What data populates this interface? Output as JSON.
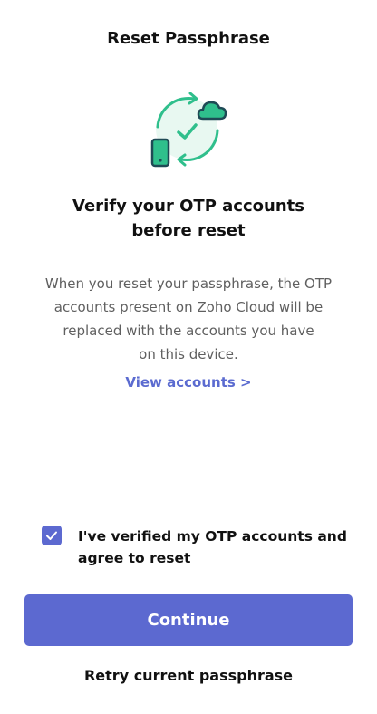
{
  "header": {
    "title": "Reset Passphrase"
  },
  "illustration": {
    "icons": [
      "phone-icon",
      "cloud-icon",
      "sync-arrows-icon",
      "checkmark-icon"
    ],
    "colors": {
      "accent_green": "#2fbf8c",
      "dark": "#1e4a55"
    }
  },
  "main": {
    "headline_line1": "Verify your OTP accounts",
    "headline_line2": "before reset",
    "description_lines": [
      "When you reset your passphrase, the OTP",
      "accounts present on Zoho Cloud will be",
      "replaced with the accounts you have",
      "on this device."
    ],
    "view_accounts_label": "View accounts >"
  },
  "agreement": {
    "checked": true,
    "label_line1": "I've verified my OTP accounts and",
    "label_line2": "agree to reset"
  },
  "actions": {
    "continue_label": "Continue",
    "retry_label": "Retry current passphrase"
  },
  "colors": {
    "primary": "#5c69d0",
    "link": "#5b6bd0",
    "text": "#111111",
    "muted_text": "#5f5f5f"
  }
}
